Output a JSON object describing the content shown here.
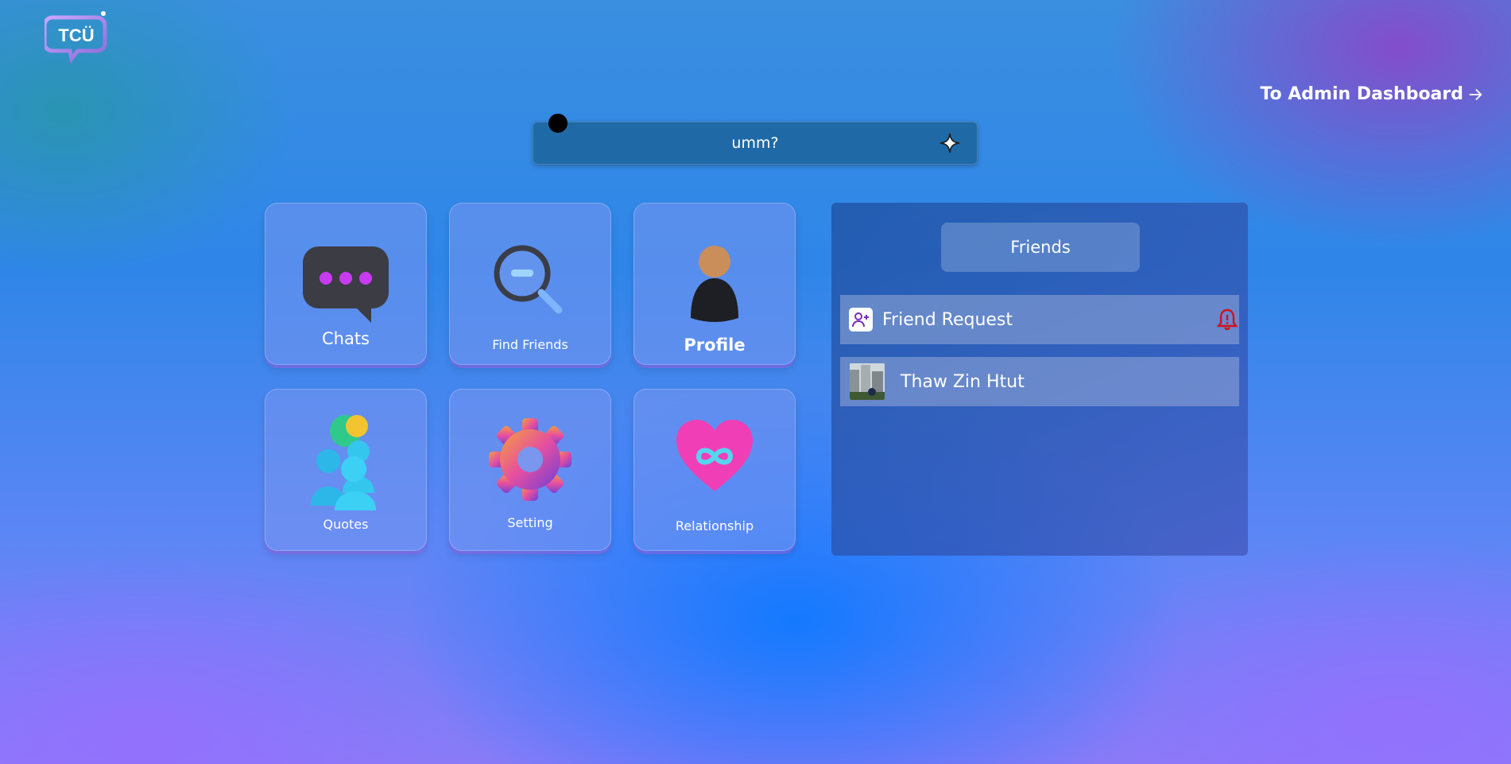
{
  "logo": {
    "text": "TCÜ"
  },
  "header": {
    "admin_link": "To Admin Dashboard"
  },
  "ai_prompt": {
    "text": "umm?"
  },
  "tiles": [
    {
      "label": "Chats"
    },
    {
      "label": "Find Friends"
    },
    {
      "label": "Profile"
    },
    {
      "label": "Quotes"
    },
    {
      "label": "Setting"
    },
    {
      "label": "Relationship"
    }
  ],
  "friends_panel": {
    "tab_label": "Friends",
    "friend_request_label": "Friend Request",
    "friends": [
      {
        "name": "Thaw Zin Htut"
      }
    ]
  },
  "colors": {
    "accent_purple": "#7b2cbf",
    "alert_red": "#d0121b"
  }
}
